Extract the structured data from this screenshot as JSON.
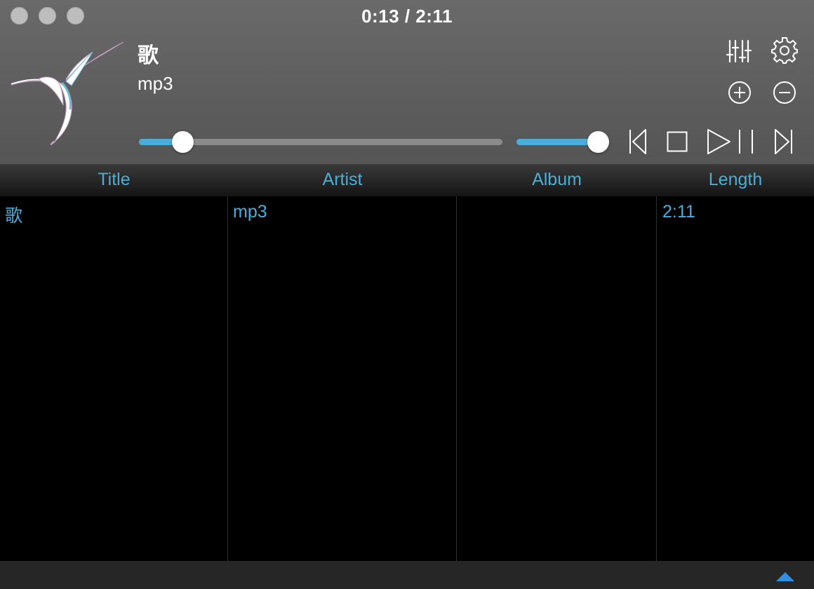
{
  "window": {
    "time_display": "0:13 / 2:11"
  },
  "now_playing": {
    "title": "歌",
    "artist": "mp3"
  },
  "controls": {
    "progress_fraction": 0.12,
    "volume_fraction": 1.0,
    "icons": {
      "equalizer": "equalizer-icon",
      "settings": "gear-icon",
      "add": "plus-circle-icon",
      "remove": "minus-circle-icon",
      "previous": "skip-previous-icon",
      "stop": "stop-icon",
      "play_pause": "play-pause-icon",
      "next": "skip-next-icon",
      "collapse": "chevron-up-icon"
    }
  },
  "playlist": {
    "columns": [
      "Title",
      "Artist",
      "Album",
      "Length"
    ],
    "rows": [
      {
        "title": "歌",
        "artist": "mp3",
        "album": "",
        "length": "2:11"
      }
    ]
  },
  "colors": {
    "accent": "#4aaed9",
    "collapse_accent": "#2f8fe0"
  }
}
